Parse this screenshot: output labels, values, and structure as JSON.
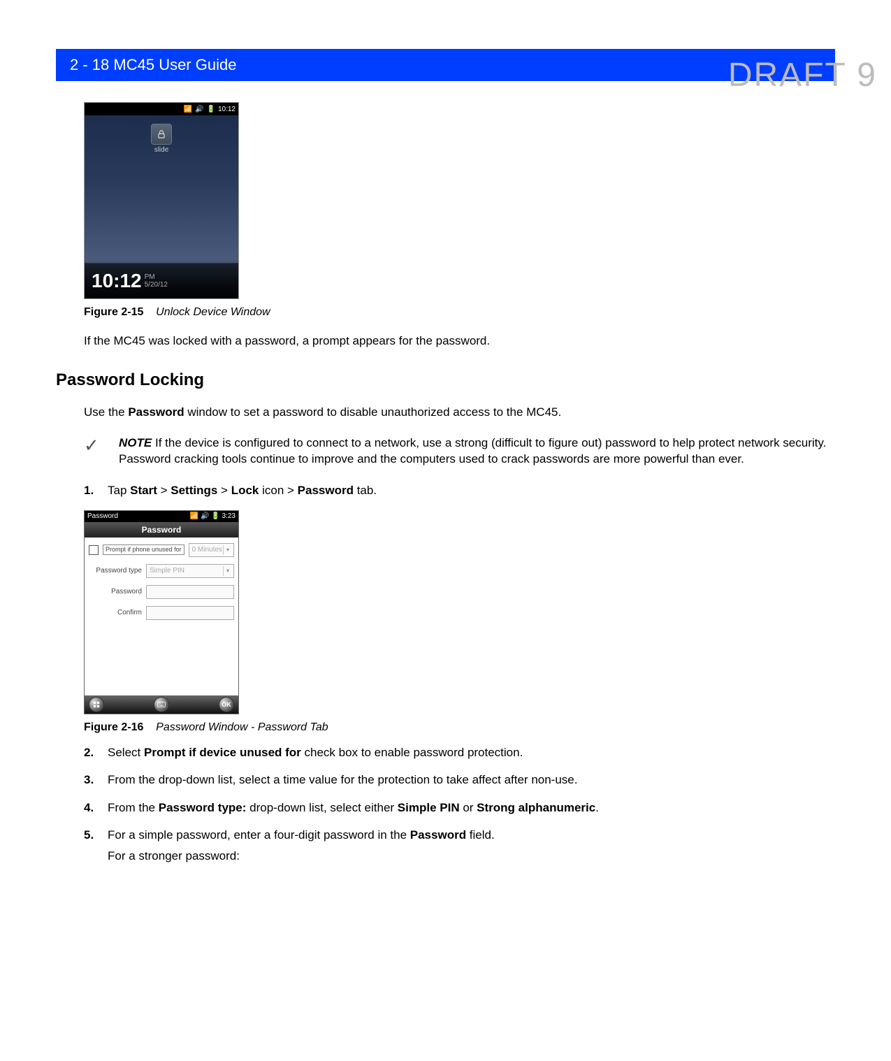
{
  "watermark": "DRAFT 9",
  "header": {
    "page_ref": "2 - 18",
    "title": "MC45 User Guide"
  },
  "figure1": {
    "topbar_time": "10:12",
    "slide_label": "slide",
    "clock_time": "10:12",
    "clock_ampm": "PM",
    "clock_date": "5/20/12",
    "caption_label": "Figure 2-15",
    "caption_text": "Unlock Device Window"
  },
  "para_after_fig1": "If the MC45 was locked with a password, a prompt appears for the password.",
  "section_heading": "Password Locking",
  "para_intro": {
    "pre": "Use the ",
    "bold": "Password",
    "post": " window to set a password to disable unauthorized access to the MC45."
  },
  "note": {
    "label": "NOTE",
    "text": "If the device is configured to connect to a network, use a strong (difficult to figure out) password to help protect network security. Password cracking tools continue to improve and the computers used to crack passwords are more powerful than ever."
  },
  "step1": {
    "num": "1.",
    "pre": "Tap ",
    "b1": "Start",
    "gt1": " > ",
    "b2": "Settings",
    "gt2": " > ",
    "b3": "Lock",
    "mid": " icon > ",
    "b4": "Password",
    "post": " tab."
  },
  "figure2": {
    "topbar_left": "Password",
    "topbar_time": "3:23",
    "title": "Password",
    "row_prompt_checkbox_label": "Prompt if phone unused for",
    "row_prompt_value": "0 Minutes",
    "row_type_label": "Password type",
    "row_type_value": "Simple PIN",
    "row_password_label": "Password",
    "row_confirm_label": "Confirm",
    "ok_label": "OK",
    "caption_label": "Figure 2-16",
    "caption_text": "Password Window - Password Tab"
  },
  "step2": {
    "num": "2.",
    "pre": "Select ",
    "b1": "Prompt if device unused for",
    "post": " check box to enable password protection."
  },
  "step3": {
    "num": "3.",
    "text": "From the drop-down list, select a time value for the protection to take affect after non-use."
  },
  "step4": {
    "num": "4.",
    "pre": "From the ",
    "b1": "Password type:",
    "mid": " drop-down list, select either ",
    "b2": "Simple PIN",
    "or": " or ",
    "b3": "Strong alphanumeric",
    "post": "."
  },
  "step5": {
    "num": "5.",
    "pre": "For a simple password, enter a four-digit password in the ",
    "b1": "Password",
    "post": " field.",
    "line2": "For a stronger password:"
  }
}
